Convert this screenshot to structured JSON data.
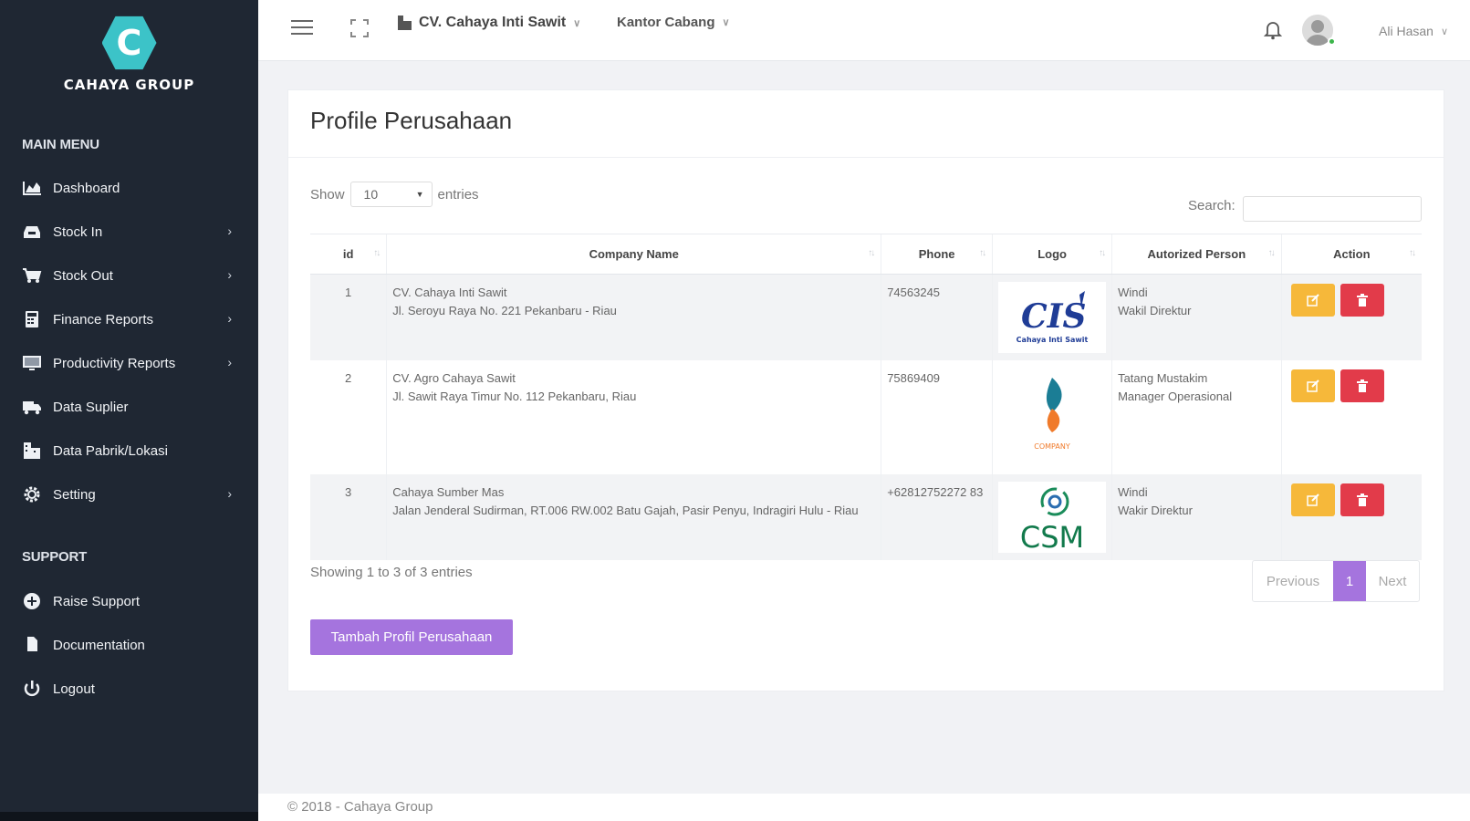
{
  "brand": {
    "initial": "C",
    "name": "CAHAYA GROUP"
  },
  "sidebar": {
    "main_heading": "MAIN MENU",
    "items": [
      {
        "label": "Dashboard",
        "icon": "chart-icon",
        "has_sub": false
      },
      {
        "label": "Stock In",
        "icon": "inbox-icon",
        "has_sub": true
      },
      {
        "label": "Stock Out",
        "icon": "cart-icon",
        "has_sub": true
      },
      {
        "label": "Finance Reports",
        "icon": "calculator-icon",
        "has_sub": true
      },
      {
        "label": "Productivity Reports",
        "icon": "monitor-icon",
        "has_sub": true
      },
      {
        "label": "Data Suplier",
        "icon": "truck-icon",
        "has_sub": false
      },
      {
        "label": "Data Pabrik/Lokasi",
        "icon": "building-icon",
        "has_sub": false
      },
      {
        "label": "Setting",
        "icon": "gear-icon",
        "has_sub": true
      }
    ],
    "support_heading": "SUPPORT",
    "support_items": [
      {
        "label": "Raise Support",
        "icon": "plus-circle-icon"
      },
      {
        "label": "Documentation",
        "icon": "file-icon"
      },
      {
        "label": "Logout",
        "icon": "power-icon"
      }
    ]
  },
  "topbar": {
    "company": "CV. Cahaya Inti Sawit",
    "branch": "Kantor Cabang",
    "user": "Ali Hasan"
  },
  "page": {
    "title": "Profile Perusahaan",
    "show_label": "Show",
    "entries_value": "10",
    "entries_label": "entries",
    "search_label": "Search:",
    "columns": [
      "id",
      "Company Name",
      "Phone",
      "Logo",
      "Autorized Person",
      "Action"
    ],
    "rows": [
      {
        "id": "1",
        "company": "CV. Cahaya Inti Sawit",
        "address": "Jl. Seroyu Raya No. 221 Pekanbaru - Riau",
        "phone": "74563245",
        "logo": "CIS",
        "logo_caption": "Cahaya Inti Sawit",
        "person": "Windi",
        "position": "Wakil Direktur"
      },
      {
        "id": "2",
        "company": "CV. Agro Cahaya Sawit",
        "address": "Jl. Sawit Raya Timur No. 112 Pekanbaru, Riau",
        "phone": "75869409",
        "logo": "COMPANY",
        "logo_caption": "COMPANY",
        "person": "Tatang Mustakim",
        "position": "Manager Operasional"
      },
      {
        "id": "3",
        "company": "Cahaya Sumber Mas",
        "address": "Jalan Jenderal Sudirman, RT.006 RW.002 Batu Gajah, Pasir Penyu, Indragiri Hulu - Riau",
        "phone": "+62812752272 83",
        "logo": "CSM",
        "logo_caption": "CSM",
        "person": "Windi",
        "position": "Wakir Direktur"
      }
    ],
    "showing": "Showing 1 to 3 of 3 entries",
    "pager": {
      "prev": "Previous",
      "current": "1",
      "next": "Next"
    },
    "add_button": "Tambah Profil Perusahaan"
  },
  "footer": "© 2018 - Cahaya Group",
  "colors": {
    "sidebar": "#1f2733",
    "accent": "#a574de",
    "edit": "#f6b83a",
    "delete": "#e23b4a",
    "brand_teal": "#3cc3c8"
  }
}
